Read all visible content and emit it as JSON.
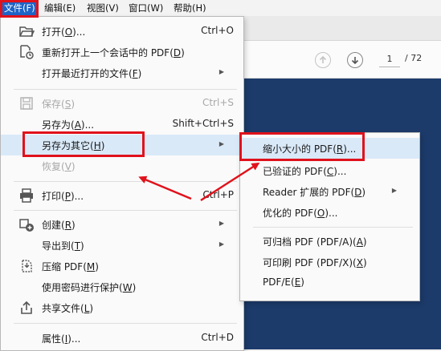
{
  "menubar": {
    "items": [
      "文件(F)",
      "编辑(E)",
      "视图(V)",
      "窗口(W)",
      "帮助(H)"
    ]
  },
  "toolbar": {
    "page_current": "1",
    "page_total": "/ 72"
  },
  "file_menu": {
    "open": {
      "label": "打开(",
      "key": "O",
      "suffix": ")...",
      "shortcut": "Ctrl+O"
    },
    "reopen": {
      "label": "重新打开上一个会话中的 PDF(",
      "key": "D",
      "suffix": ")"
    },
    "recent": {
      "label": "打开最近打开的文件(",
      "key": "F",
      "suffix": ")"
    },
    "save": {
      "label": "保存(",
      "key": "S",
      "suffix": ")",
      "shortcut": "Ctrl+S"
    },
    "save_as": {
      "label": "另存为(",
      "key": "A",
      "suffix": ")...",
      "shortcut": "Shift+Ctrl+S"
    },
    "save_as_other": {
      "label": "另存为其它(",
      "key": "H",
      "suffix": ")"
    },
    "revert": {
      "label": "恢复(",
      "key": "V",
      "suffix": ")"
    },
    "print": {
      "label": "打印(",
      "key": "P",
      "suffix": ")...",
      "shortcut": "Ctrl+P"
    },
    "create": {
      "label": "创建(",
      "key": "R",
      "suffix": ")"
    },
    "export": {
      "label": "导出到(",
      "key": "T",
      "suffix": ")"
    },
    "compress": {
      "label": "压缩 PDF(",
      "key": "M",
      "suffix": ")"
    },
    "protect": {
      "label": "使用密码进行保护(",
      "key": "W",
      "suffix": ")"
    },
    "share": {
      "label": "共享文件(",
      "key": "L",
      "suffix": ")"
    },
    "properties": {
      "label": "属性(",
      "key": "I",
      "suffix": ")...",
      "shortcut": "Ctrl+D"
    }
  },
  "save_as_other_menu": {
    "reduced": {
      "label": "缩小大小的 PDF(",
      "key": "R",
      "suffix": ")..."
    },
    "certified": {
      "label": "已验证的 PDF(",
      "key": "C",
      "suffix": ")..."
    },
    "reader_extended": {
      "label": "Reader 扩展的 PDF(",
      "key": "D",
      "suffix": ")"
    },
    "optimized": {
      "label": "优化的 PDF(",
      "key": "O",
      "suffix": ")..."
    },
    "archivable": {
      "label": "可归档 PDF (PDF/A)(",
      "key": "A",
      "suffix": ")"
    },
    "printable": {
      "label": "可印刷 PDF (PDF/X)(",
      "key": "X",
      "suffix": ")"
    },
    "pdfe": {
      "label": "PDF/E(",
      "key": "E",
      "suffix": ")"
    }
  },
  "colors": {
    "accent": "#1e64c8",
    "annotation": "#e0121b",
    "doc_background": "#1c3b6b",
    "selected_row": "#d9e9f8"
  }
}
